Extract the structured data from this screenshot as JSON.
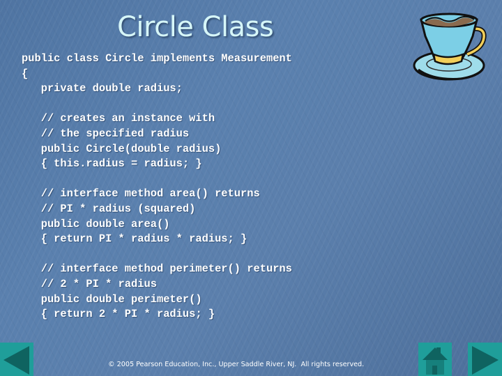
{
  "slide": {
    "title": "Circle Class",
    "code_lines": [
      "public class Circle implements Measurement",
      "{",
      "   private double radius;",
      "",
      "   // creates an instance with",
      "   // the specified radius",
      "   public Circle(double radius)",
      "   { this.radius = radius; }",
      "",
      "   // interface method area() returns",
      "   // PI * radius (squared)",
      "   public double area()",
      "   { return PI * radius * radius; }",
      "",
      "   // interface method perimeter() returns",
      "   // 2 * PI * radius",
      "   public double perimeter()",
      "   { return 2 * PI * radius; }"
    ],
    "decoration_icon": "coffee-cup-icon",
    "footer": "© 2005 Pearson Education, Inc., Upper Saddle River, NJ.  All rights reserved."
  },
  "navigation": {
    "prev_icon": "previous-slide-icon",
    "home_icon": "home-icon",
    "next_icon": "next-slide-icon",
    "button_color": "#1f9e9a",
    "glyph_color": "#0f6360"
  },
  "colors": {
    "background": "#567ba8",
    "title": "#d6f6f8",
    "code": "#ffffff"
  }
}
